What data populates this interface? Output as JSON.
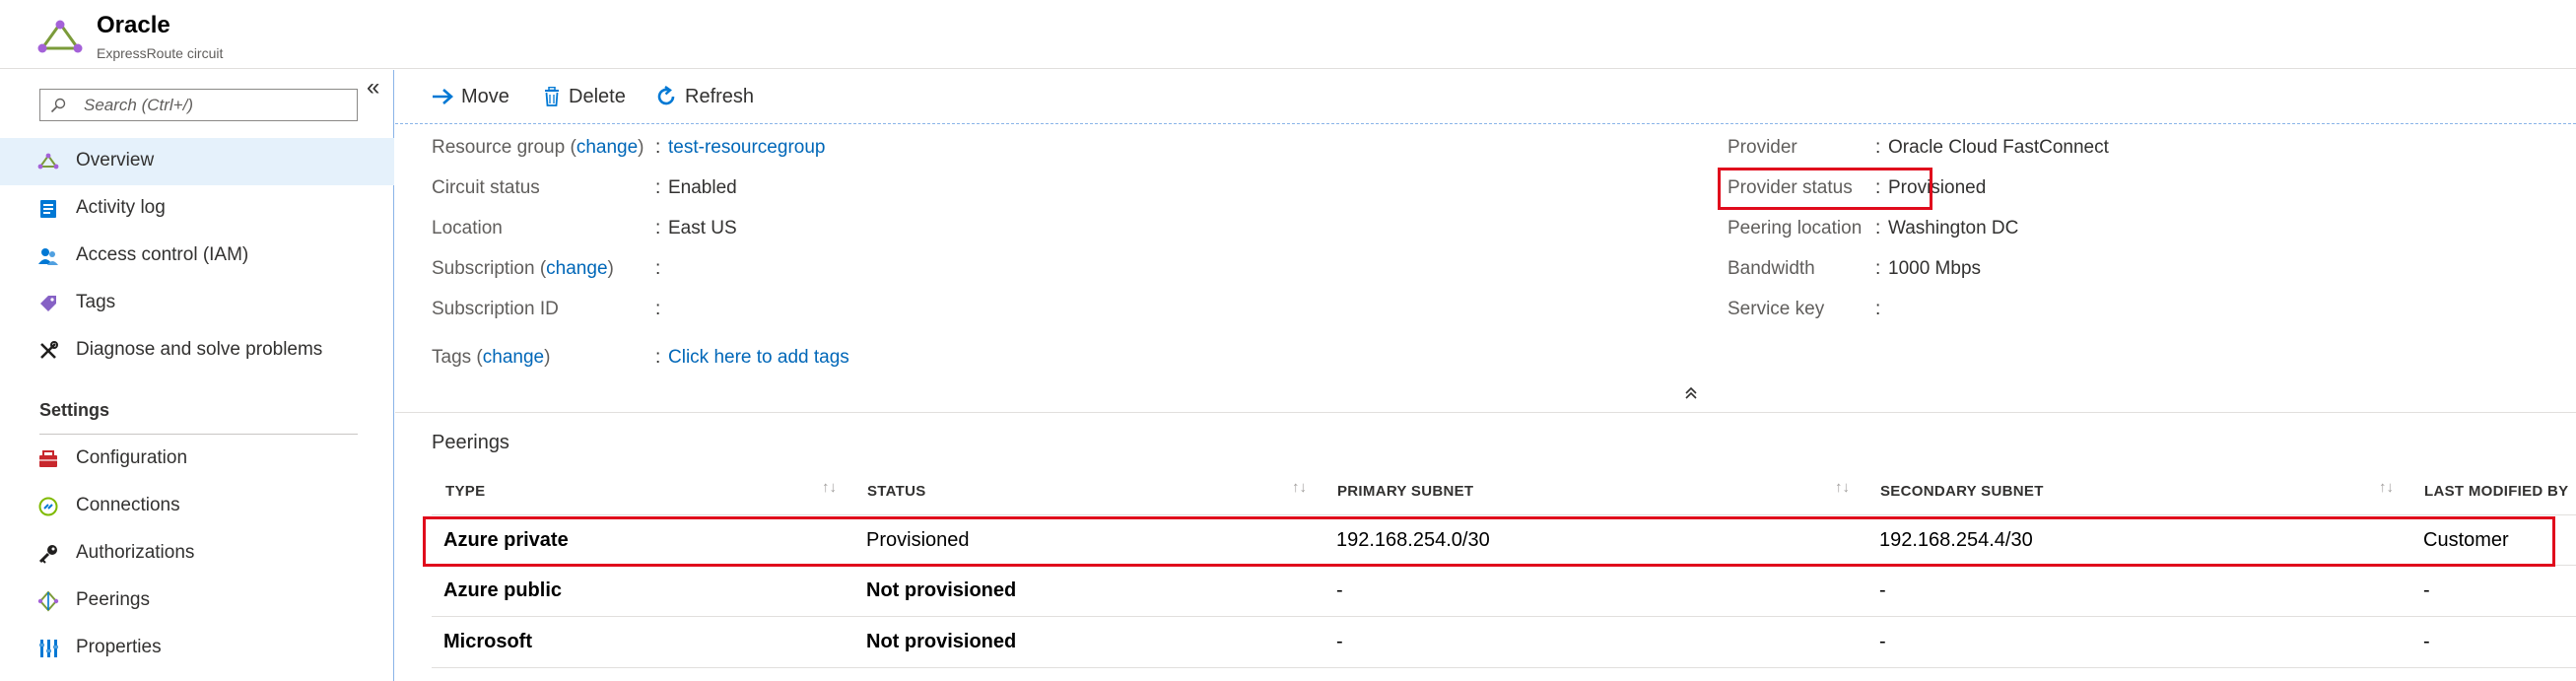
{
  "header": {
    "title": "Oracle",
    "subtitle": "ExpressRoute circuit"
  },
  "sidebar": {
    "search_placeholder": "Search (Ctrl+/)",
    "collapse_glyph": "«",
    "items": [
      {
        "label": "Overview",
        "icon": "overview-icon"
      },
      {
        "label": "Activity log",
        "icon": "activity-log-icon"
      },
      {
        "label": "Access control (IAM)",
        "icon": "iam-icon"
      },
      {
        "label": "Tags",
        "icon": "tag-icon"
      },
      {
        "label": "Diagnose and solve problems",
        "icon": "wrench-icon"
      }
    ],
    "settings_section": "Settings",
    "settings_items": [
      {
        "label": "Configuration",
        "icon": "configuration-icon"
      },
      {
        "label": "Connections",
        "icon": "connections-icon"
      },
      {
        "label": "Authorizations",
        "icon": "key-icon"
      },
      {
        "label": "Peerings",
        "icon": "peerings-icon"
      },
      {
        "label": "Properties",
        "icon": "properties-icon"
      }
    ]
  },
  "toolbar": {
    "move": "Move",
    "delete": "Delete",
    "refresh": "Refresh"
  },
  "essentials": {
    "left": [
      {
        "label": "Resource group",
        "change": "change",
        "value": "test-resourcegroup",
        "value_is_link": true
      },
      {
        "label": "Circuit status",
        "value": "Enabled"
      },
      {
        "label": "Location",
        "value": "East US"
      },
      {
        "label": "Subscription",
        "change": "change",
        "value": ""
      },
      {
        "label": "Subscription ID",
        "value": ""
      },
      {
        "label": "Tags",
        "change": "change",
        "value": "Click here to add tags",
        "value_is_link": true
      }
    ],
    "right": [
      {
        "label": "Provider",
        "value": "Oracle Cloud FastConnect"
      },
      {
        "label": "Provider status",
        "value": "Provisioned"
      },
      {
        "label": "Peering location",
        "value": "Washington DC"
      },
      {
        "label": "Bandwidth",
        "value": "1000 Mbps"
      },
      {
        "label": "Service key",
        "value": ""
      }
    ],
    "colon": ":",
    "paren_open": "(",
    "paren_close": ")"
  },
  "peerings": {
    "title": "Peerings",
    "sort_glyph": "↑↓",
    "columns": [
      "TYPE",
      "STATUS",
      "PRIMARY SUBNET",
      "SECONDARY SUBNET",
      "LAST MODIFIED BY"
    ],
    "rows": [
      {
        "type": "Azure private",
        "status": "Provisioned",
        "primary": "192.168.254.0/30",
        "secondary": "192.168.254.4/30",
        "modified_by": "Customer"
      },
      {
        "type": "Azure public",
        "status": "Not provisioned",
        "primary": "-",
        "secondary": "-",
        "modified_by": "-"
      },
      {
        "type": "Microsoft",
        "status": "Not provisioned",
        "primary": "-",
        "secondary": "-",
        "modified_by": "-"
      }
    ]
  },
  "colors": {
    "accent": "#0067b8",
    "highlight": "#e00b1c",
    "active_nav": "#e5f1fb"
  }
}
